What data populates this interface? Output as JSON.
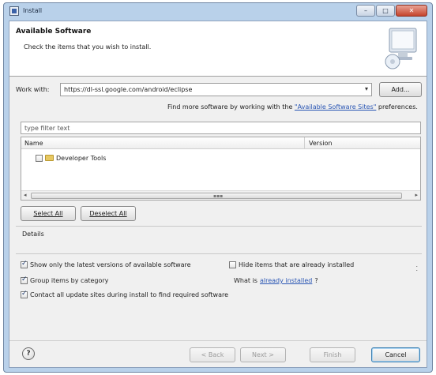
{
  "window": {
    "title": "Install",
    "minimize_glyph": "–",
    "maximize_glyph": "□",
    "close_glyph": "✕"
  },
  "banner": {
    "title": "Available Software",
    "description": "Check the items that you wish to install."
  },
  "work_with": {
    "label": "Work with:",
    "value": "https://dl-ssl.google.com/android/eclipse",
    "add_button": "Add...",
    "more_prefix": "Find more software by working with the",
    "more_link": "\"Available Software Sites\"",
    "more_suffix": "preferences."
  },
  "filter": {
    "placeholder": "type filter text"
  },
  "tree": {
    "columns": [
      "Name",
      "Version"
    ],
    "rows": [
      {
        "label": "Developer Tools",
        "checked": false,
        "version": ""
      }
    ],
    "scroll_left": "◂",
    "scroll_right": "▸",
    "scroll_grip": "▪▪▪"
  },
  "actions": {
    "select_all": "Select All",
    "deselect_all": "Deselect All"
  },
  "details": {
    "label": "Details",
    "scroll_marker": "⁚"
  },
  "options": {
    "latest_versions": {
      "label": "Show only the latest versions of available software",
      "checked": true
    },
    "hide_installed": {
      "label": "Hide items that are already installed",
      "checked": false
    },
    "group_by_category": {
      "label": "Group items by category",
      "checked": true
    },
    "what_is_prefix": "What is",
    "already_installed_link": "already installed",
    "what_is_suffix": "?",
    "contact_sites": {
      "label": "Contact all update sites during install to find required software",
      "checked": true
    }
  },
  "footer": {
    "help": "?",
    "back": "< Back",
    "next": "Next >",
    "finish": "Finish",
    "cancel": "Cancel"
  }
}
